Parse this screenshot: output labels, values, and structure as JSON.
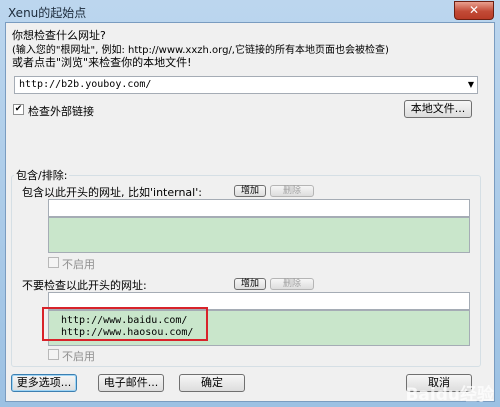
{
  "window": {
    "title": "Xenu的起始点",
    "close_glyph": "✕"
  },
  "prompt": {
    "heading": "你想检查什么网址?",
    "hint": "(输入您的\"根网址\", 例如: http://www.xxzh.org/,它链接的所有本地页面也会被检查)",
    "local_hint": "或者点击\"浏览\"来检查你的本地文件!"
  },
  "url_input": {
    "value": "http://b2b.youboy.com/"
  },
  "check_external": {
    "label": "检查外部链接",
    "checked": true
  },
  "local_file_button": "本地文件...",
  "include_exclude": {
    "group_label": "包含/排除:",
    "include": {
      "label": "包含以此开头的网址, 比如'internal':",
      "add_button": "增加",
      "remove_button": "删除",
      "input_value": "",
      "list_items": [],
      "disable_label": "不启用",
      "disable_checked": false
    },
    "exclude": {
      "label": "不要检查以此开头的网址:",
      "add_button": "增加",
      "remove_button": "删除",
      "input_value": "",
      "list_items": [
        "http://www.baidu.com/",
        "http://www.haosou.com/"
      ],
      "disable_label": "不启用",
      "disable_checked": false
    }
  },
  "footer": {
    "more_options": "更多选项...",
    "email": "电子邮件...",
    "ok": "确定",
    "cancel": "取消"
  },
  "watermark": "Baidu经验",
  "colors": {
    "highlight_box": "#d8232a",
    "list_bg": "#c9e6cb"
  }
}
